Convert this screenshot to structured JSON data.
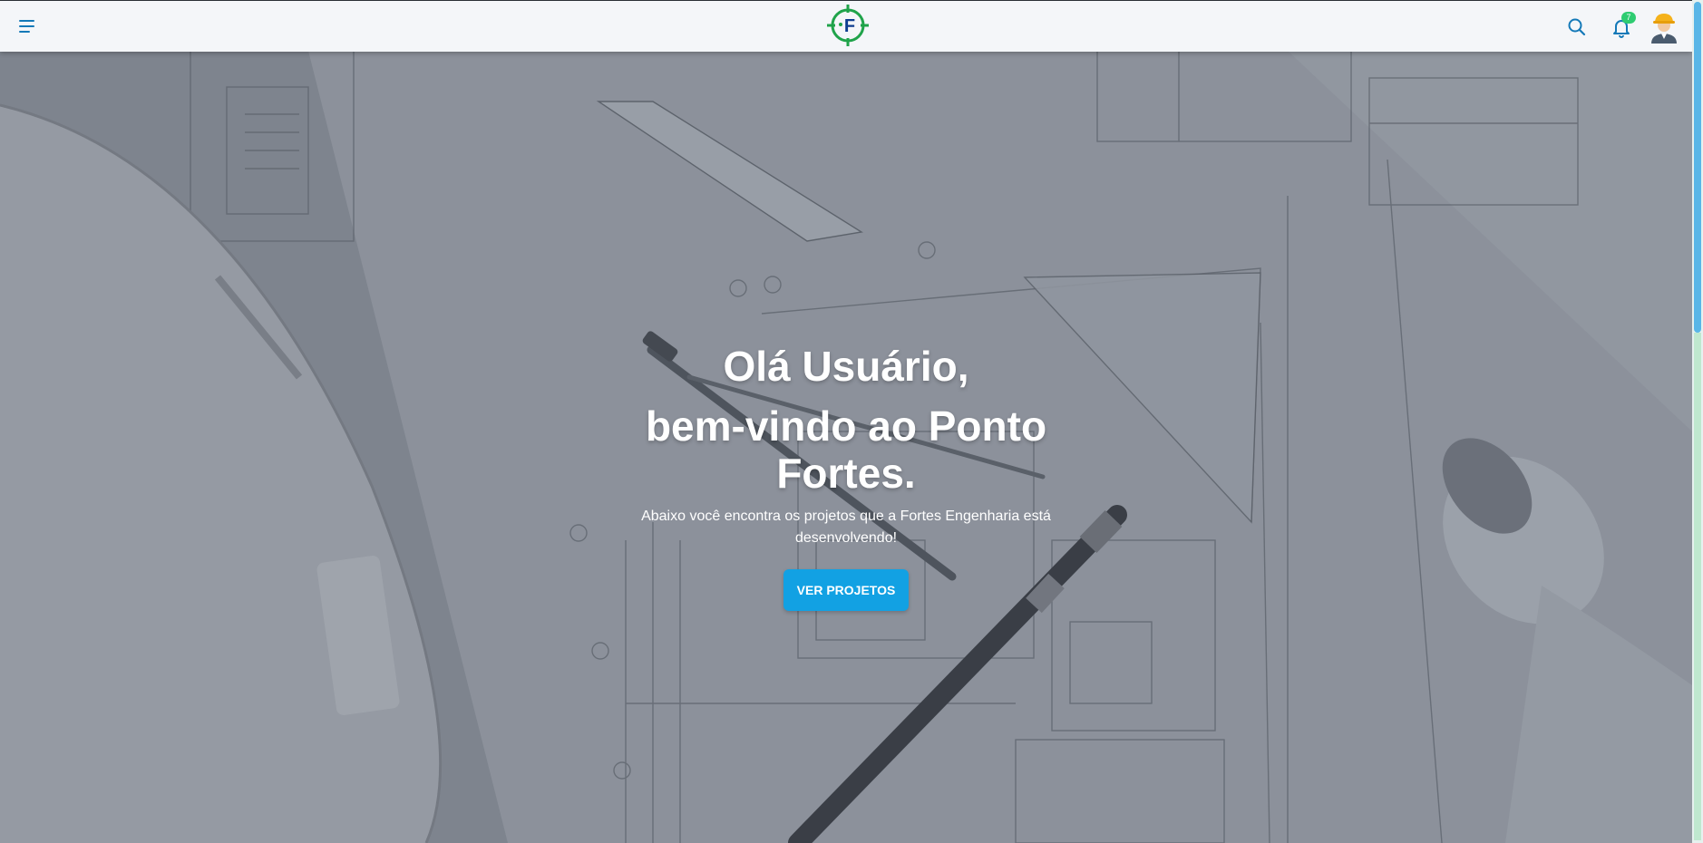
{
  "header": {
    "menu_icon": "hamburger-menu-icon",
    "logo_letter": "F",
    "logo_icon": "crosshair-logo-icon",
    "search_icon": "search-icon",
    "bell_icon": "bell-icon",
    "notification_count": "7",
    "avatar_icon": "engineer-avatar-icon"
  },
  "hero": {
    "greeting": "Olá Usuário,",
    "welcome": "bem-vindo ao Ponto Fortes.",
    "subtitle": "Abaixo você encontra os projetos que a Fortes Engenharia está desenvolvendo!",
    "cta_label": "VER PROJETOS"
  },
  "colors": {
    "primary": "#1479b8",
    "cta": "#12a1e3",
    "badge": "#2ecc71",
    "logo_green": "#1fa34a",
    "logo_blue": "#0d3d8f"
  }
}
